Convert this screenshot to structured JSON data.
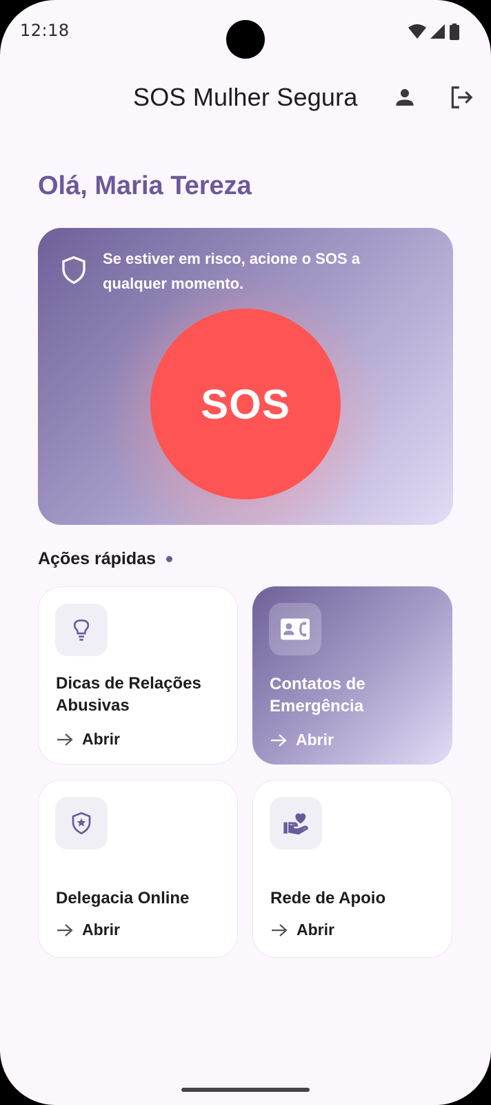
{
  "status_bar": {
    "time": "12:18"
  },
  "app_bar": {
    "title": "SOS Mulher Segura",
    "icons": [
      "person-icon",
      "logout-icon"
    ]
  },
  "greeting": "Olá, Maria Tereza",
  "sos_card": {
    "hint": "Se estiver em risco, acione o SOS a qualquer momento.",
    "button_label": "SOS"
  },
  "quick_actions": {
    "title": "Ações rápidas",
    "tiles": [
      {
        "label": "Dicas de Relações Abusivas",
        "action": "Abrir",
        "icon": "lightbulb-icon"
      },
      {
        "label": "Contatos de Emergência",
        "action": "Abrir",
        "icon": "contact-phone-icon"
      },
      {
        "label": "Delegacia Online",
        "action": "Abrir",
        "icon": "police-badge-icon"
      },
      {
        "label": "Rede de Apoio",
        "action": "Abrir",
        "icon": "volunteer-heart-icon"
      }
    ]
  },
  "colors": {
    "accent": "#6a5a9a",
    "sos_red": "#fe5454",
    "background": "#fcf7fd"
  }
}
